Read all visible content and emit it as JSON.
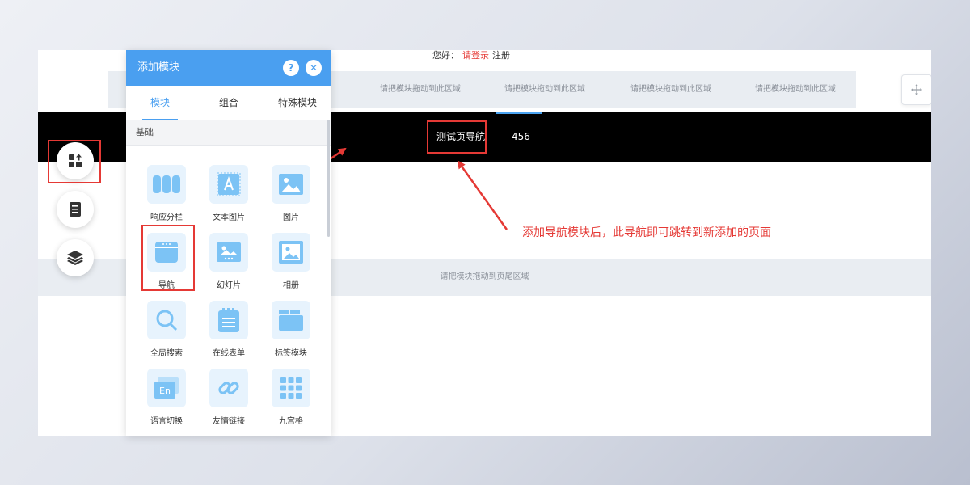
{
  "site": {
    "greeting": "您好：",
    "login_link": "请登录",
    "register_link": "注册",
    "header_drop_zones": [
      "请把模块拖动到此区域",
      "请把模块拖动到此区域",
      "请把模块拖动到此区域",
      "请把模块拖动到此区域"
    ],
    "nav_items": [
      "测试页导航",
      "456"
    ],
    "footer_drop_zone": "请把模块拖动到页尾区域"
  },
  "panel": {
    "title": "添加模块",
    "help_label": "?",
    "close_label": "✕",
    "tabs": [
      "模块",
      "组合",
      "特殊模块"
    ],
    "active_tab": "模块",
    "section_label": "基础",
    "modules": [
      {
        "label": "响应分栏",
        "icon": "columns-icon"
      },
      {
        "label": "文本图片",
        "icon": "text-image-icon"
      },
      {
        "label": "图片",
        "icon": "image-icon"
      },
      {
        "label": "导航",
        "icon": "navigation-icon"
      },
      {
        "label": "幻灯片",
        "icon": "slideshow-icon"
      },
      {
        "label": "相册",
        "icon": "album-icon"
      },
      {
        "label": "全局搜索",
        "icon": "search-icon"
      },
      {
        "label": "在线表单",
        "icon": "form-icon"
      },
      {
        "label": "标签模块",
        "icon": "tabs-icon"
      },
      {
        "label": "语言切换",
        "icon": "language-icon"
      },
      {
        "label": "友情链接",
        "icon": "link-icon"
      },
      {
        "label": "九宫格",
        "icon": "grid-icon"
      }
    ]
  },
  "sidebar": {
    "buttons": [
      {
        "icon": "add-module-icon"
      },
      {
        "icon": "page-icon"
      },
      {
        "icon": "layers-icon"
      }
    ]
  },
  "annotation": {
    "text": "添加导航模块后，此导航即可跳转到新添加的页面"
  },
  "colors": {
    "accent": "#4a9ff0",
    "annotation_red": "#e53935",
    "nav_bar": "#000000"
  }
}
